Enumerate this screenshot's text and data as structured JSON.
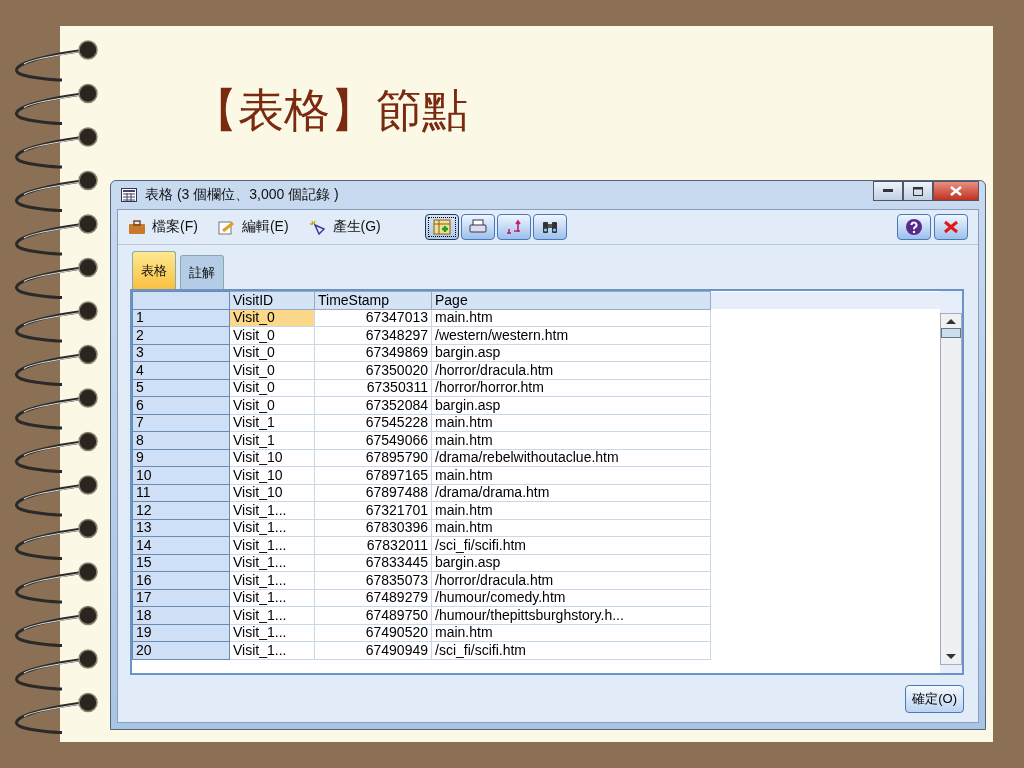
{
  "slide": {
    "title": "【表格】節點"
  },
  "window": {
    "title": "表格 (3 個欄位、3,000 個記錄 )"
  },
  "menus": [
    {
      "kind": "file",
      "label": "檔案(F)"
    },
    {
      "kind": "edit",
      "label": "編輯(E)"
    },
    {
      "kind": "generate",
      "label": "產生(G)"
    }
  ],
  "toolbar_buttons": [
    {
      "kind": "table",
      "selected": true
    },
    {
      "kind": "print",
      "selected": false
    },
    {
      "kind": "sort",
      "selected": false
    },
    {
      "kind": "find",
      "selected": false
    }
  ],
  "tabs": [
    {
      "label": "表格",
      "selected": true
    },
    {
      "label": "註解",
      "selected": false
    }
  ],
  "table": {
    "columns": [
      "VisitID",
      "TimeStamp",
      "Page"
    ],
    "rows": [
      {
        "index": "1",
        "visit_id": "Visit_0",
        "timestamp": "67347013",
        "page": "main.htm",
        "selected": true
      },
      {
        "index": "2",
        "visit_id": "Visit_0",
        "timestamp": "67348297",
        "page": "/western/western.htm",
        "selected": false
      },
      {
        "index": "3",
        "visit_id": "Visit_0",
        "timestamp": "67349869",
        "page": "bargin.asp",
        "selected": false
      },
      {
        "index": "4",
        "visit_id": "Visit_0",
        "timestamp": "67350020",
        "page": "/horror/dracula.htm",
        "selected": false
      },
      {
        "index": "5",
        "visit_id": "Visit_0",
        "timestamp": "67350311",
        "page": "/horror/horror.htm",
        "selected": false
      },
      {
        "index": "6",
        "visit_id": "Visit_0",
        "timestamp": "67352084",
        "page": "bargin.asp",
        "selected": false
      },
      {
        "index": "7",
        "visit_id": "Visit_1",
        "timestamp": "67545228",
        "page": "main.htm",
        "selected": false
      },
      {
        "index": "8",
        "visit_id": "Visit_1",
        "timestamp": "67549066",
        "page": "main.htm",
        "selected": false
      },
      {
        "index": "9",
        "visit_id": "Visit_10",
        "timestamp": "67895790",
        "page": "/drama/rebelwithoutaclue.htm",
        "selected": false
      },
      {
        "index": "10",
        "visit_id": "Visit_10",
        "timestamp": "67897165",
        "page": "main.htm",
        "selected": false
      },
      {
        "index": "11",
        "visit_id": "Visit_10",
        "timestamp": "67897488",
        "page": "/drama/drama.htm",
        "selected": false
      },
      {
        "index": "12",
        "visit_id": "Visit_1...",
        "timestamp": "67321701",
        "page": "main.htm",
        "selected": false
      },
      {
        "index": "13",
        "visit_id": "Visit_1...",
        "timestamp": "67830396",
        "page": "main.htm",
        "selected": false
      },
      {
        "index": "14",
        "visit_id": "Visit_1...",
        "timestamp": "67832011",
        "page": "/sci_fi/scifi.htm",
        "selected": false
      },
      {
        "index": "15",
        "visit_id": "Visit_1...",
        "timestamp": "67833445",
        "page": "bargin.asp",
        "selected": false
      },
      {
        "index": "16",
        "visit_id": "Visit_1...",
        "timestamp": "67835073",
        "page": "/horror/dracula.htm",
        "selected": false
      },
      {
        "index": "17",
        "visit_id": "Visit_1...",
        "timestamp": "67489279",
        "page": "/humour/comedy.htm",
        "selected": false
      },
      {
        "index": "18",
        "visit_id": "Visit_1...",
        "timestamp": "67489750",
        "page": "/humour/thepittsburghstory.h...",
        "selected": false
      },
      {
        "index": "19",
        "visit_id": "Visit_1...",
        "timestamp": "67490520",
        "page": "main.htm",
        "selected": false
      },
      {
        "index": "20",
        "visit_id": "Visit_1...",
        "timestamp": "67490949",
        "page": "/sci_fi/scifi.htm",
        "selected": false
      }
    ]
  },
  "ok_button": "確定(O)"
}
